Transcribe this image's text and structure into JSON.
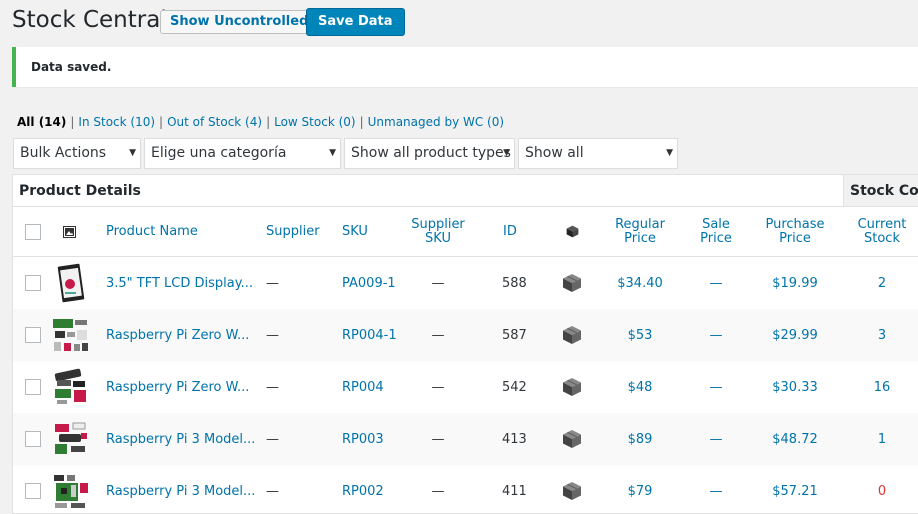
{
  "header": {
    "title": "Stock Central",
    "show_uncontrolled_label": "Show Uncontrolled",
    "save_label": "Save Data"
  },
  "notice": {
    "text": "Data saved."
  },
  "views": [
    {
      "label": "All (14)",
      "current": true
    },
    {
      "label": "In Stock (10)",
      "current": false
    },
    {
      "label": "Out of Stock (4)",
      "current": false
    },
    {
      "label": "Low Stock (0)",
      "current": false
    },
    {
      "label": "Unmanaged by WC (0)",
      "current": false
    }
  ],
  "filters": {
    "bulk_actions": "Bulk Actions",
    "category": "Elige una categoría",
    "product_type": "Show all product types",
    "stock_status": "Show all"
  },
  "table": {
    "groups": {
      "product_details": "Product Details",
      "stock_counts": "Stock Counts"
    },
    "columns": {
      "product_name": "Product Name",
      "supplier": "Supplier",
      "sku": "SKU",
      "supplier_sku": "Supplier SKU",
      "id": "ID",
      "regular_price": "Regular Price",
      "sale_price": "Sale Price",
      "purchase_price": "Purchase Price",
      "current_stock": "Current Stock"
    },
    "icons": {
      "thumbnail_column": "image-icon",
      "type_column": "box-icon"
    },
    "rows": [
      {
        "name": "3.5\" TFT LCD Display...",
        "supplier": "—",
        "sku": "PA009-1",
        "supplier_sku": "—",
        "id": "588",
        "regular_price": "$34.40",
        "sale_price": "—",
        "purchase_price": "$19.99",
        "current_stock": "2",
        "thumb": "lcd-display"
      },
      {
        "name": "Raspberry Pi Zero W...",
        "supplier": "—",
        "sku": "RP004-1",
        "supplier_sku": "—",
        "id": "587",
        "regular_price": "$53",
        "sale_price": "—",
        "purchase_price": "$29.99",
        "current_stock": "3",
        "thumb": "pi-zero-kit"
      },
      {
        "name": "Raspberry Pi Zero W...",
        "supplier": "—",
        "sku": "RP004",
        "supplier_sku": "—",
        "id": "542",
        "regular_price": "$48",
        "sale_price": "—",
        "purchase_price": "$30.33",
        "current_stock": "16",
        "thumb": "pi-zero-kit-2"
      },
      {
        "name": "Raspberry Pi 3 Model...",
        "supplier": "—",
        "sku": "RP003",
        "supplier_sku": "—",
        "id": "413",
        "regular_price": "$89",
        "sale_price": "—",
        "purchase_price": "$48.72",
        "current_stock": "1",
        "thumb": "pi3-kit"
      },
      {
        "name": "Raspberry Pi 3 Model...",
        "supplier": "—",
        "sku": "RP002",
        "supplier_sku": "—",
        "id": "411",
        "regular_price": "$79",
        "sale_price": "—",
        "purchase_price": "$57.21",
        "current_stock": "0",
        "thumb": "pi3-board"
      }
    ]
  },
  "colors": {
    "accent": "#0073aa",
    "primary_button": "#0085ba",
    "success": "#46b450",
    "out_of_stock": "#dc3232"
  }
}
